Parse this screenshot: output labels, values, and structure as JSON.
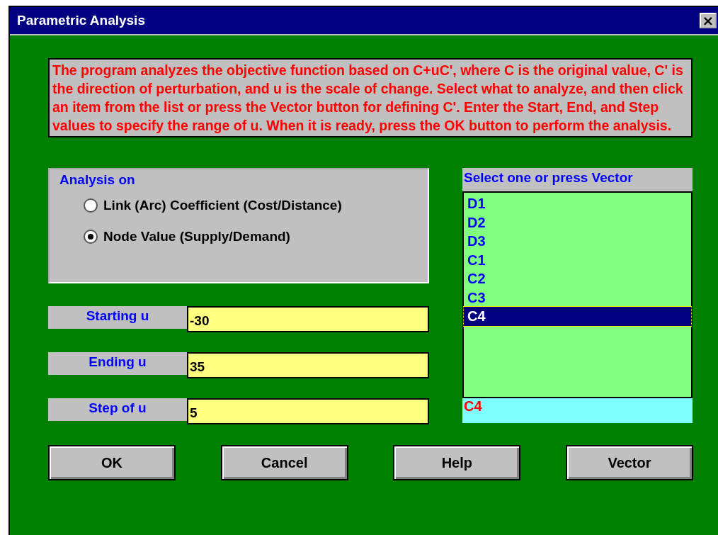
{
  "window": {
    "title": "Parametric Analysis",
    "close": "×"
  },
  "info": "The program analyzes the objective function based on C+uC', where C is the original value, C' is the direction of perturbation, and u is the scale of change.  Select what to analyze, and then click an item from the list or press the Vector button for defining C'.  Enter the Start, End, and Step values to specify the range of u.  When it is ready, press the OK button to perform the analysis.",
  "analysis_on": {
    "title": "Analysis on",
    "options": [
      {
        "label": "Link (Arc) Coefficient (Cost/Distance)",
        "selected": false
      },
      {
        "label": "Node Value (Supply/Demand)",
        "selected": true
      }
    ]
  },
  "fields": [
    {
      "label": "Starting u",
      "value": "-30"
    },
    {
      "label": "Ending u",
      "value": "35"
    },
    {
      "label": "Step of u",
      "value": "5"
    }
  ],
  "list": {
    "header": "Select one or press Vector",
    "items": [
      {
        "label": "D1",
        "selected": false
      },
      {
        "label": "D2",
        "selected": false
      },
      {
        "label": "D3",
        "selected": false
      },
      {
        "label": "C1",
        "selected": false
      },
      {
        "label": "C2",
        "selected": false
      },
      {
        "label": "C3",
        "selected": false
      },
      {
        "label": "C4",
        "selected": true
      }
    ],
    "current": "C4"
  },
  "buttons": [
    "OK",
    "Cancel",
    "Help",
    "Vector"
  ]
}
